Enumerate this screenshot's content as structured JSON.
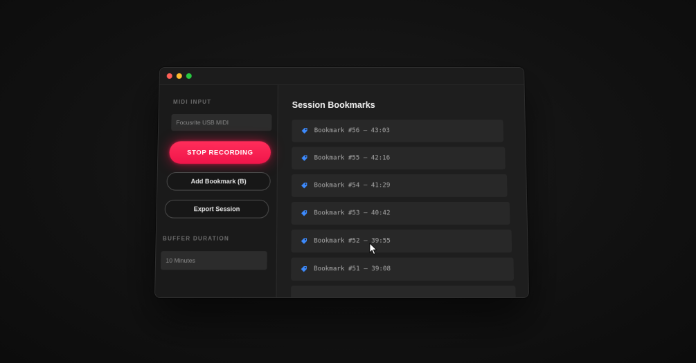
{
  "window": {
    "controls": [
      {
        "name": "close",
        "color": "#ff5f57"
      },
      {
        "name": "minimize",
        "color": "#febc2e"
      },
      {
        "name": "maximize",
        "color": "#28c840"
      }
    ]
  },
  "sidebar": {
    "midi_label": "MIDI INPUT",
    "midi_device": "Focusrite USB MIDI",
    "stop_recording_label": "STOP RECORDING",
    "add_bookmark_label": "Add Bookmark (B)",
    "export_session_label": "Export Session",
    "buffer_label": "BUFFER DURATION",
    "buffer_value": "10 Minutes"
  },
  "main": {
    "title": "Session Bookmarks",
    "bookmarks": [
      {
        "icon": "bookmark-tag-icon",
        "label": "Bookmark #56 — 43:03"
      },
      {
        "icon": "bookmark-tag-icon",
        "label": "Bookmark #55 — 42:16"
      },
      {
        "icon": "bookmark-tag-icon",
        "label": "Bookmark #54 — 41:29"
      },
      {
        "icon": "bookmark-tag-icon",
        "label": "Bookmark #53 — 40:42"
      },
      {
        "icon": "bookmark-tag-icon",
        "label": "Bookmark #52 — 39:55"
      },
      {
        "icon": "bookmark-tag-icon",
        "label": "Bookmark #51 — 39:08"
      }
    ]
  },
  "colors": {
    "accent_record": "#ff2457",
    "bookmark_icon": "#3d8bff"
  }
}
